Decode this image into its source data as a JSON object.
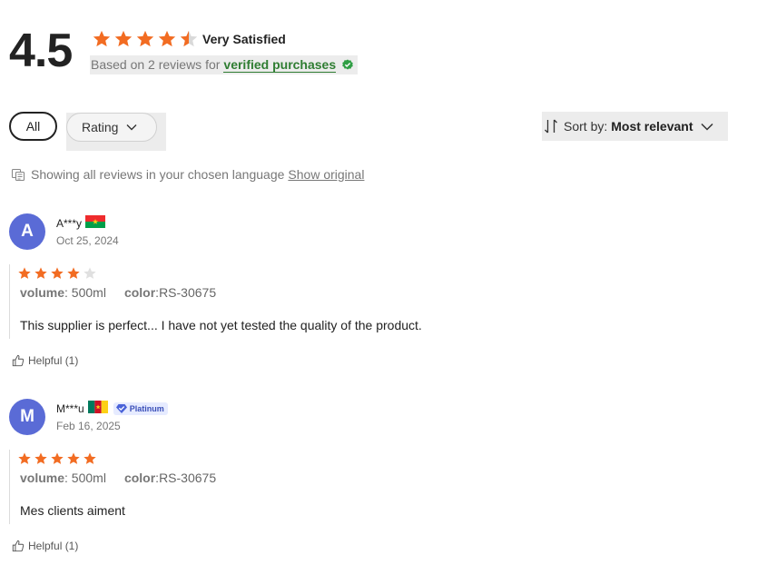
{
  "summary": {
    "score": "4.5",
    "stars": 4.5,
    "satisfaction_label": "Very Satisfied",
    "based_on_text": "Based on 2 reviews for",
    "verified_link": "verified purchases",
    "star_color": "#f26c22",
    "verified_color": "#2f7d32"
  },
  "filters": {
    "all_label": "All",
    "rating_label": "Rating",
    "sort_prefix": "Sort by:",
    "sort_value": "Most relevant"
  },
  "language_notice": {
    "text": "Showing all reviews in your chosen language",
    "link": "Show original"
  },
  "reviews": [
    {
      "initial": "A",
      "name": "A***y",
      "flag": "burkina-faso-flag",
      "date": "Oct 25, 2024",
      "stars": 4,
      "attrs": [
        {
          "key": "volume",
          "value": "500ml"
        },
        {
          "key": "color",
          "value": "RS-30675"
        }
      ],
      "text": "This supplier is perfect... I have not yet tested the quality of the product.",
      "helpful": "Helpful (1)"
    },
    {
      "initial": "M",
      "name": "M***u",
      "flag": "cameroon-flag",
      "badge": "Platinum",
      "date": "Feb 16, 2025",
      "stars": 5,
      "attrs": [
        {
          "key": "volume",
          "value": "500ml"
        },
        {
          "key": "color",
          "value": "RS-30675"
        }
      ],
      "text": "Mes clients aiment",
      "helpful": "Helpful (1)"
    }
  ],
  "avatar_color": "#5a6bd6"
}
